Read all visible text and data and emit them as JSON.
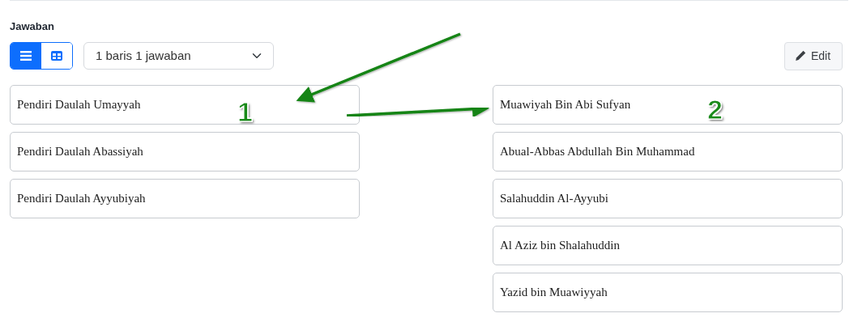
{
  "section": {
    "title": "Jawaban"
  },
  "view_toggle": [
    {
      "kind": "list",
      "selected": true
    },
    {
      "kind": "grid",
      "selected": false
    }
  ],
  "layout_select": {
    "value": "1 baris 1 jawaban"
  },
  "edit_button": {
    "label": "Edit"
  },
  "questions": [
    {
      "text": "Pendiri Daulah Umayyah"
    },
    {
      "text": "Pendiri Daulah Abassiyah"
    },
    {
      "text": "Pendiri Daulah Ayyubiyah"
    }
  ],
  "answers": [
    {
      "text": "Muawiyah Bin Abi Sufyan"
    },
    {
      "text": "Abual-Abbas Abdullah Bin Muhammad"
    },
    {
      "text": "Salahuddin Al-Ayyubi"
    },
    {
      "text": "Al Aziz bin Shalahuddin"
    },
    {
      "text": "Yazid bin Muawiyyah"
    }
  ],
  "annotations": [
    {
      "label": "1"
    },
    {
      "label": "2"
    }
  ]
}
